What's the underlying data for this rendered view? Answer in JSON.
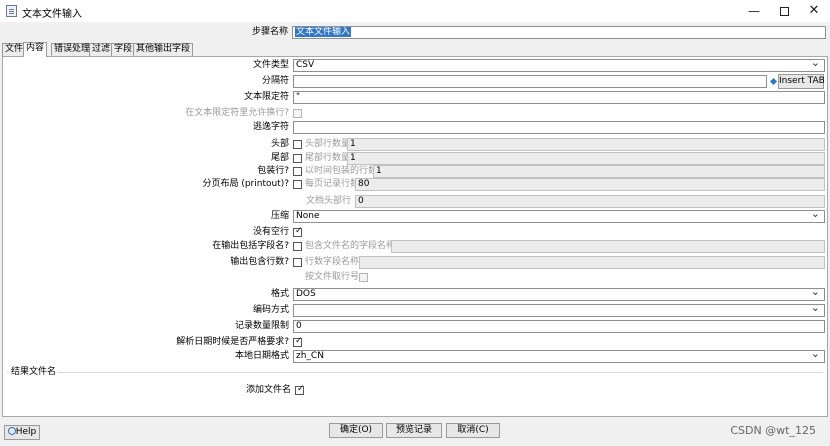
{
  "window": {
    "title": "文本文件输入",
    "minimize": "—",
    "close": "✕"
  },
  "step": {
    "label": "步骤名称",
    "value": "文本文件输入"
  },
  "tabs": [
    "文件",
    "内容",
    "错误处理",
    "过滤",
    "字段",
    "其他输出字段"
  ],
  "content": {
    "file_type": {
      "label": "文件类型",
      "value": "CSV"
    },
    "separator": {
      "label": "分隔符",
      "value": "",
      "insert_tab": "Insert TAB"
    },
    "enclosure": {
      "label": "文本限定符",
      "value": "\""
    },
    "break_in_enclosure": {
      "label": "在文本限定符里允许换行?"
    },
    "escape": {
      "label": "逃逸字符",
      "value": ""
    },
    "header": {
      "label": "头部",
      "option": "头部行数量",
      "value": "1"
    },
    "footer": {
      "label": "尾部",
      "option": "尾部行数量",
      "value": "1"
    },
    "wrapped": {
      "label": "包装行?",
      "option": "以时间包装的行数",
      "value": "1"
    },
    "paged": {
      "label": "分页布局 (printout)?",
      "option": "每页记录行数",
      "value": "80",
      "doc_header_label": "文档头部行",
      "doc_header_value": "0"
    },
    "compression": {
      "label": "压缩",
      "value": "None"
    },
    "no_empty_rows": {
      "label": "没有空行",
      "checked": true
    },
    "include_filename": {
      "label": "在输出包括字段名?",
      "option": "包含文件名的字段名称",
      "value": ""
    },
    "include_rownum": {
      "label": "输出包含行数?",
      "option": "行数字段名称",
      "value": "",
      "by_file_label": "按文件取行号"
    },
    "format": {
      "label": "格式",
      "value": "DOS"
    },
    "encoding": {
      "label": "编码方式",
      "value": ""
    },
    "limit": {
      "label": "记录数量限制",
      "value": "0"
    },
    "lenient_date": {
      "label": "解析日期时候是否严格要求?",
      "checked": true
    },
    "date_locale": {
      "label": "本地日期格式",
      "value": "zh_CN"
    }
  },
  "result_filename": {
    "group_title": "结果文件名",
    "add_label": "添加文件名",
    "checked": true
  },
  "footer": {
    "help": "Help",
    "ok": "确定(O)",
    "preview": "预览记录",
    "cancel": "取消(C)"
  },
  "watermark": "CSDN @wt_125",
  "colors": {
    "selection": "#3178c6",
    "help_icon": "#2c77c9"
  }
}
